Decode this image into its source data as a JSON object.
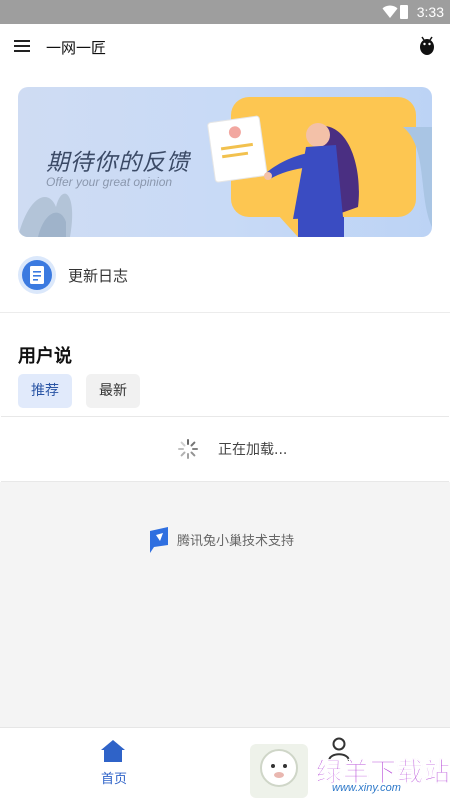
{
  "status_bar": {
    "time": "3:33"
  },
  "app_bar": {
    "title": "一网一匠"
  },
  "banner": {
    "title": "期待你的反馈",
    "subtitle": "Offer your great opinion"
  },
  "changelog": {
    "label": "更新日志"
  },
  "section": {
    "title": "用户说"
  },
  "tabs": [
    {
      "label": "推荐",
      "active": true
    },
    {
      "label": "最新",
      "active": false
    }
  ],
  "loading": {
    "text": "正在加载..."
  },
  "support": {
    "text": "腾讯兔小巢技术支持"
  },
  "bottom_nav": {
    "home_label": "首页"
  },
  "watermark": {
    "text": "绿羊下载站",
    "site": "www.xiny.com"
  },
  "colors": {
    "accent": "#2f63c8",
    "banner_bg": "#c8daf6",
    "status_bar": "#9e9e9e",
    "page_bg": "#f4f4f4"
  }
}
